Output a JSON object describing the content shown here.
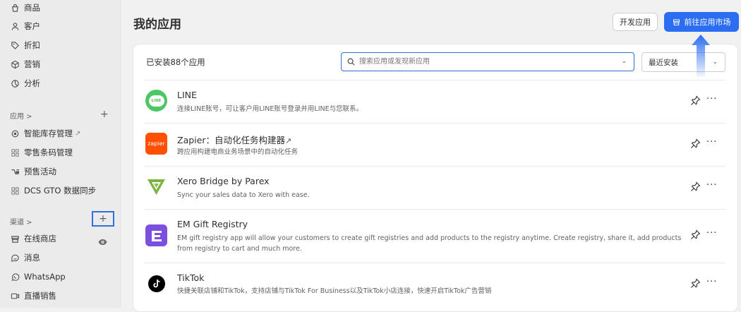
{
  "sidebar": {
    "main_items": [
      {
        "label": "商品",
        "icon": "bag-icon"
      },
      {
        "label": "客户",
        "icon": "person-icon"
      },
      {
        "label": "折扣",
        "icon": "tag-icon"
      },
      {
        "label": "营销",
        "icon": "target-icon"
      },
      {
        "label": "分析",
        "icon": "chart-pie-icon"
      }
    ],
    "apps_section": "应用 >",
    "apps_items": [
      {
        "label": "智能库存管理",
        "icon": "stock-icon",
        "external": true
      },
      {
        "label": "零售条码管理",
        "icon": "apps-icon"
      },
      {
        "label": "预售活动",
        "icon": "presale-icon"
      },
      {
        "label": "DCS GTO 数据同步",
        "icon": "apps-icon"
      }
    ],
    "channels_section": "渠道 >",
    "channel_items": [
      {
        "label": "在线商店",
        "icon": "store-icon"
      },
      {
        "label": "消息",
        "icon": "chat-icon"
      },
      {
        "label": "WhatsApp",
        "icon": "whatsapp-icon"
      },
      {
        "label": "直播销售",
        "icon": "live-icon"
      }
    ]
  },
  "header": {
    "title": "我的应用",
    "dev_button": "开发应用",
    "market_button": "前往应用市场"
  },
  "toolbar": {
    "count_label": "已安装88个应用",
    "search_placeholder": "搜索应用或发现新应用",
    "sort_value": "最近安装"
  },
  "apps": [
    {
      "name": "LINE",
      "desc": [
        "连接LINE账号，可让客户用LINE账号登录并用LINE与您联系。"
      ],
      "logo": "line-logo",
      "color": "#4cc764"
    },
    {
      "name": "Zapier：自动化任务构建器",
      "desc": [
        "跨应用构建电商业务场景中的自动化任务"
      ],
      "logo": "zapier-logo",
      "color": "#ff4f00",
      "external": true
    },
    {
      "name": "Xero Bridge by Parex",
      "desc": [
        "Sync your sales data to Xero with ease."
      ],
      "logo": "xero-bridge-logo",
      "color": "#7cb342"
    },
    {
      "name": "EM Gift Registry",
      "desc": [
        "EM gift registry app will allow your customers to create gift registries and add products to the registry anytime. Create registry, share it, add products",
        "from registry to cart and much more."
      ],
      "logo": "em-gift-logo",
      "color": "#7b4fe0"
    },
    {
      "name": "TikTok",
      "desc": [
        "快捷关联店铺和TikTok，支持店铺与TikTok For Business以及TikTok小店连接，快速开启TikTok广告营销"
      ],
      "logo": "tiktok-logo",
      "color": "#000000"
    }
  ],
  "zapier_text": "zapier",
  "line_text": "LINE"
}
